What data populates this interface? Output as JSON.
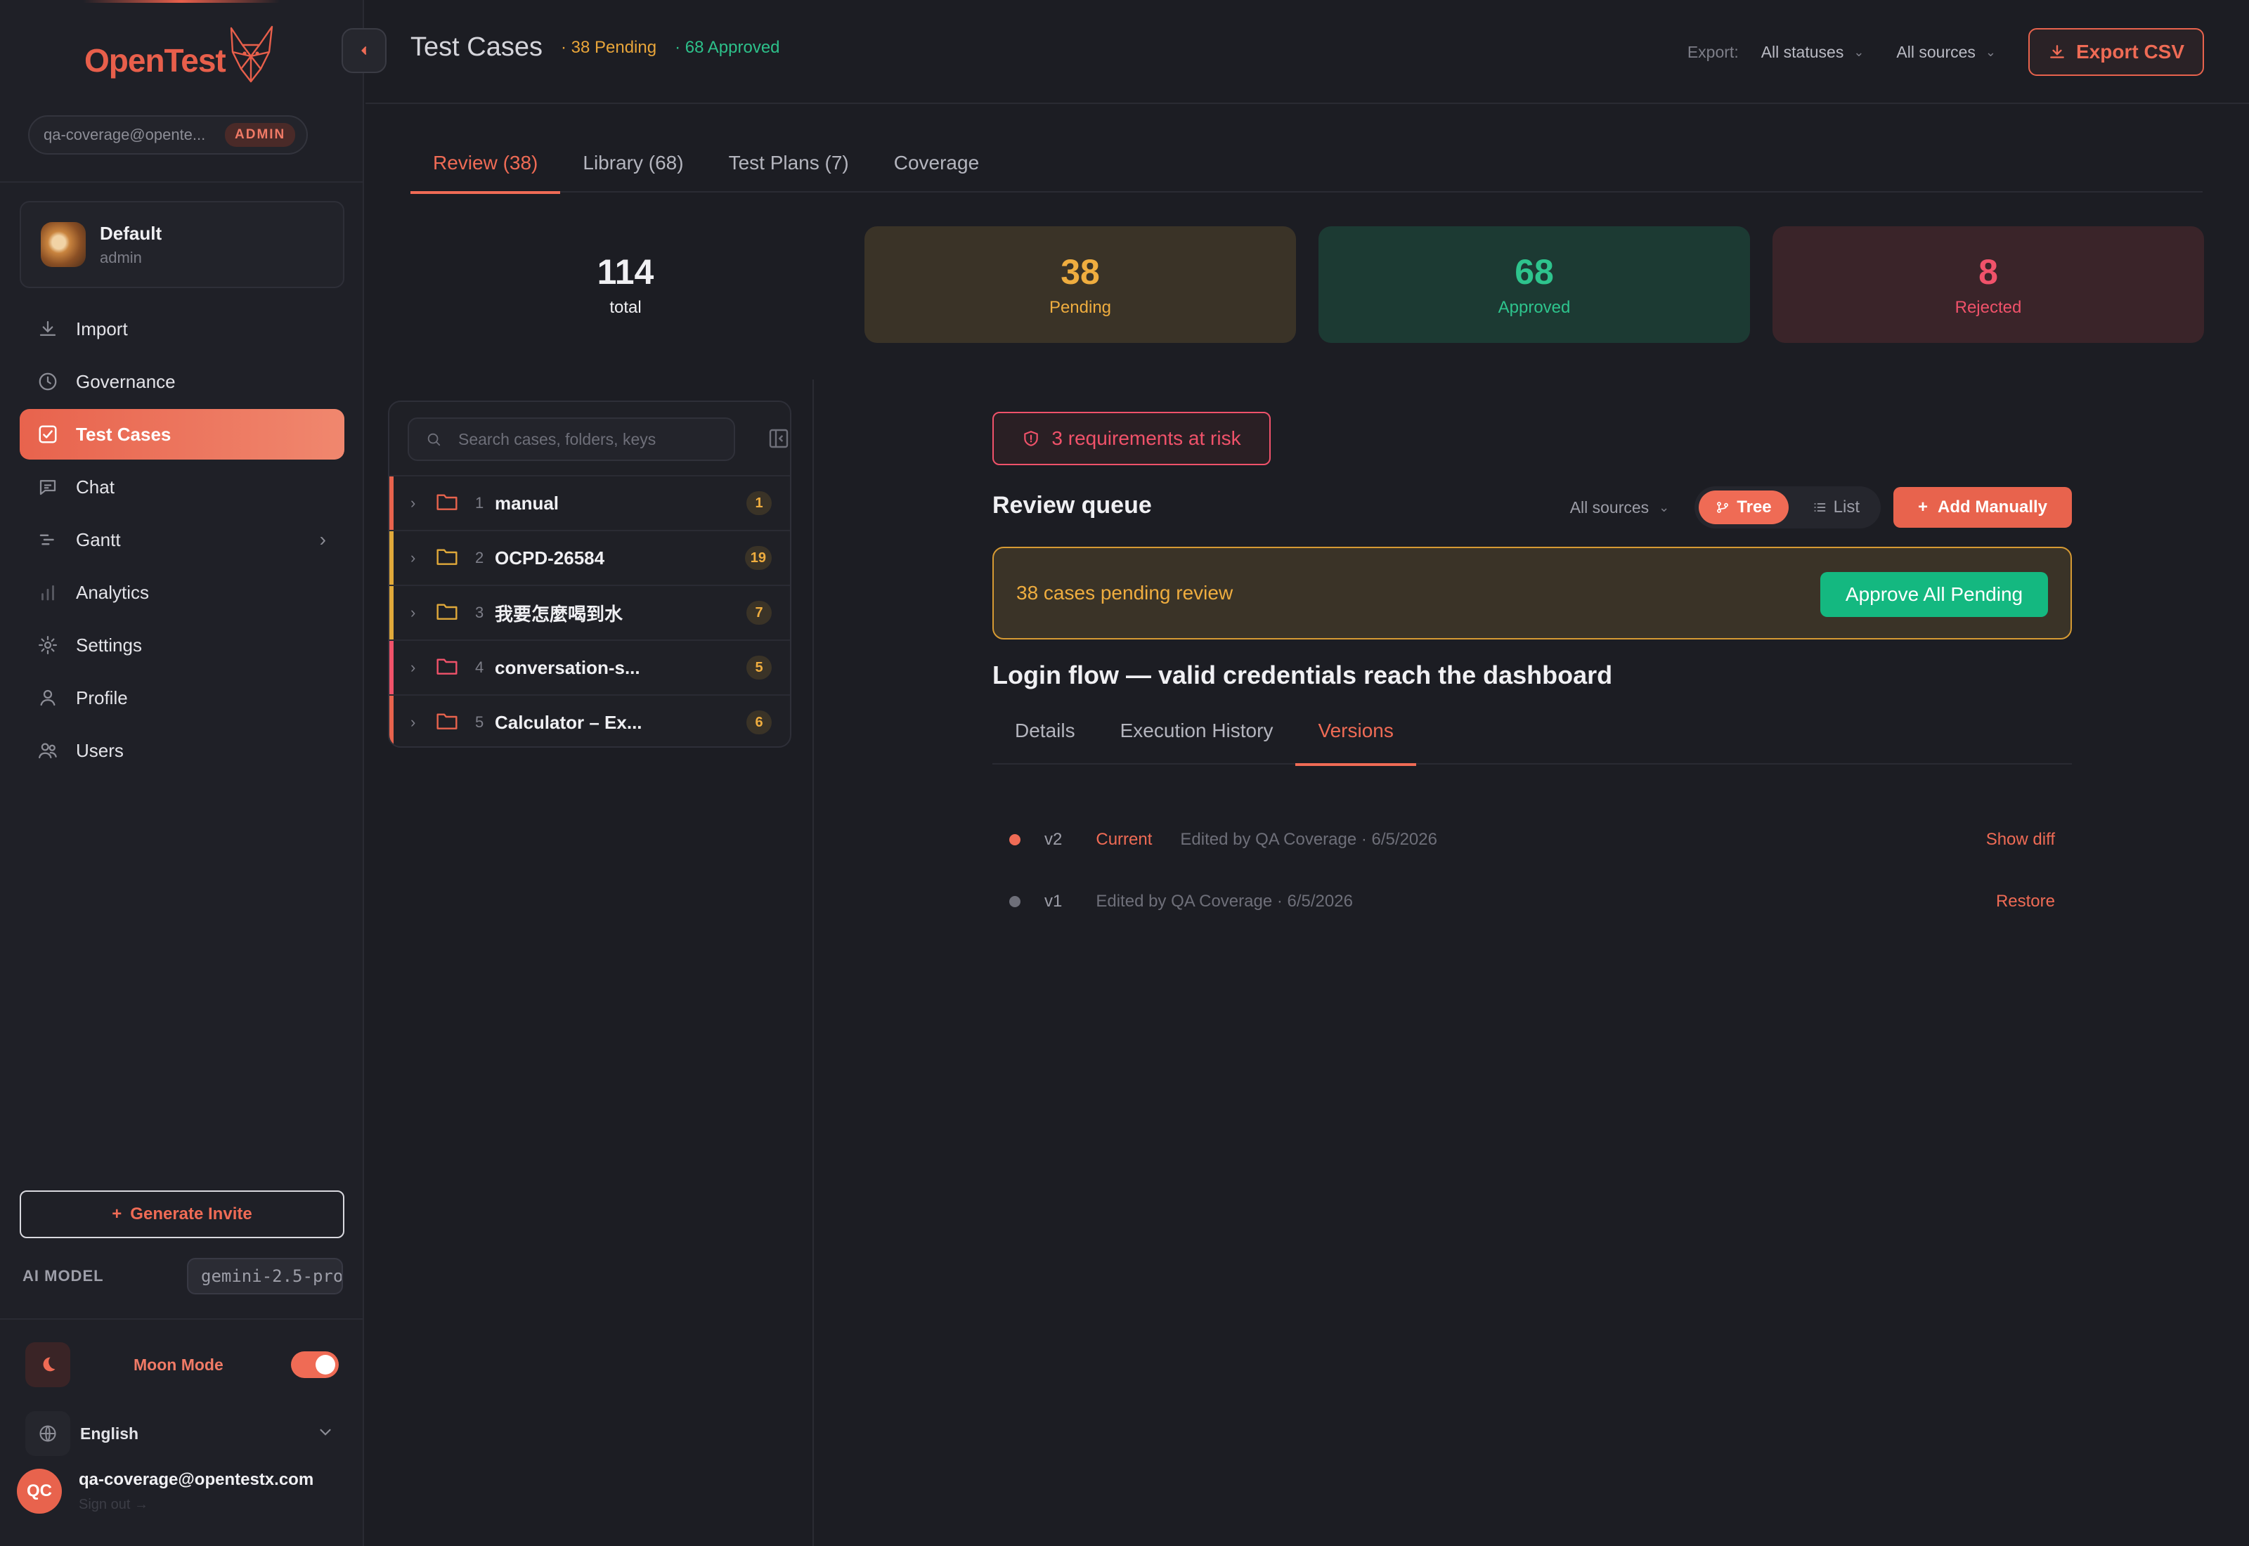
{
  "sidebar": {
    "brand": "OpenTest",
    "user_email_short": "qa-coverage@opente...",
    "role_badge": "ADMIN",
    "workspace": {
      "name": "Default",
      "role": "admin"
    },
    "nav": [
      {
        "label": "Import",
        "icon": "download-icon"
      },
      {
        "label": "Governance",
        "icon": "clock-icon"
      },
      {
        "label": "Test Cases",
        "icon": "checkbox-icon",
        "active": true
      },
      {
        "label": "Chat",
        "icon": "chat-icon"
      },
      {
        "label": "Gantt",
        "icon": "gantt-icon",
        "has_chevron": true
      },
      {
        "label": "Analytics",
        "icon": "bar-chart-icon"
      },
      {
        "label": "Settings",
        "icon": "gear-icon"
      },
      {
        "label": "Profile",
        "icon": "person-icon"
      },
      {
        "label": "Users",
        "icon": "users-icon"
      }
    ],
    "invite_button": "Generate Invite",
    "ai_model_label": "AI MODEL",
    "ai_model_value": "gemini-2.5-pro",
    "moon_mode_label": "Moon Mode",
    "moon_mode_on": true,
    "language": "English",
    "account_initials": "QC",
    "account_email": "qa-coverage@opentestx.com",
    "sign_out": "Sign out →"
  },
  "header": {
    "title": "Test Cases",
    "pending_pill": "· 38 Pending",
    "approved_pill": "· 68 Approved",
    "export_label": "Export:",
    "status_filter": "All statuses",
    "source_filter": "All sources",
    "export_button": "Export CSV"
  },
  "tabs": [
    "Review (38)",
    "Library (68)",
    "Test Plans (7)",
    "Coverage"
  ],
  "stats": {
    "total": {
      "value": "114",
      "label": "total"
    },
    "pending": {
      "value": "38",
      "label": "Pending"
    },
    "approved": {
      "value": "68",
      "label": "Approved"
    },
    "rejected": {
      "value": "8",
      "label": "Rejected"
    }
  },
  "tree": {
    "search_placeholder": "Search cases, folders, keys",
    "folders": [
      {
        "index": "1",
        "name": "manual",
        "count": "1",
        "accent": "#e8634d",
        "folder_color": "#e8634d"
      },
      {
        "index": "2",
        "name": "OCPD-26584",
        "count": "19",
        "accent": "#e0a93a",
        "folder_color": "#e0a93a"
      },
      {
        "index": "3",
        "name": "我要怎麼喝到水",
        "count": "7",
        "accent": "#e0a93a",
        "folder_color": "#e0a93a"
      },
      {
        "index": "4",
        "name": "conversation-s...",
        "count": "5",
        "accent": "#f0526a",
        "folder_color": "#f0526a"
      },
      {
        "index": "5",
        "name": "Calculator – Ex...",
        "count": "6",
        "accent": "#e8634d",
        "folder_color": "#e8634d"
      }
    ]
  },
  "review": {
    "risk_badge": "3 requirements at risk",
    "queue_title": "Review queue",
    "sources_filter": "All sources",
    "view_tree": "Tree",
    "view_list": "List",
    "add_manually": "Add Manually",
    "pending_banner": "38 cases pending review",
    "approve_all": "Approve All Pending",
    "case_title": "Login flow — valid credentials reach the dashboard",
    "case_tabs": [
      "Details",
      "Execution History",
      "Versions"
    ],
    "versions": [
      {
        "version": "v2",
        "tag": "Current",
        "meta": "Edited by QA Coverage · 6/5/2026",
        "action": "Show diff",
        "dot": "#ef6b55"
      },
      {
        "version": "v1",
        "tag": "",
        "meta": "Edited by QA Coverage · 6/5/2026",
        "action": "Restore",
        "dot": "#6e6f79"
      }
    ]
  },
  "colors": {
    "accent": "#e8634d",
    "pending": "#efad3f",
    "approved": "#2ec48d",
    "rejected": "#f0526a",
    "background": "#1c1d23"
  }
}
